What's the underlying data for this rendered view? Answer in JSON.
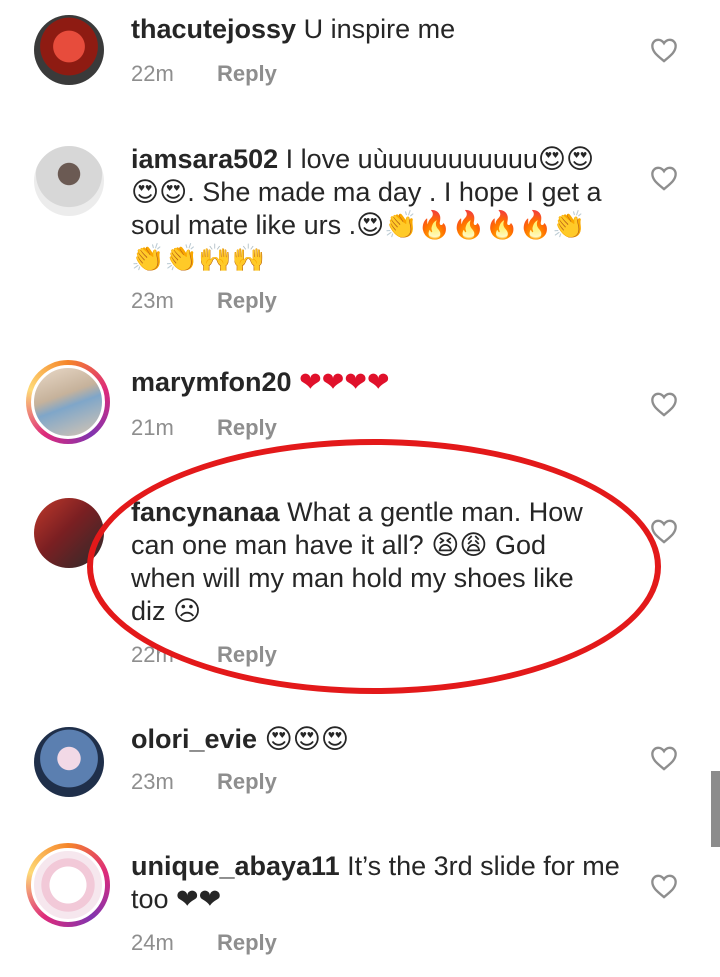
{
  "comments": [
    {
      "username": "thacutejossy",
      "text": " U inspire me",
      "time": "22m",
      "reply": "Reply",
      "ring": false,
      "avatar_color": "#c0392b"
    },
    {
      "username": "iamsara502",
      "text": " I love uùuuuuuuuuuu😍😍 😍😍. She made ma day . I hope I get a soul mate like urs .😍👏🔥🔥🔥🔥👏 👏👏🙌🙌",
      "time": "23m",
      "reply": "Reply",
      "ring": false,
      "avatar_color": "#bdbdbd"
    },
    {
      "username": "marymfon20",
      "text": " ❤❤❤❤",
      "time": "21m",
      "reply": "Reply",
      "ring": true,
      "avatar_color": "#7fa6c9"
    },
    {
      "username": "fancynanaa",
      "text": " What a gentle man. How can one man have it all? 😫😩 God when will my man hold my shoes like diz ☹",
      "time": "22m",
      "reply": "Reply",
      "ring": false,
      "avatar_color": "#7a1f22"
    },
    {
      "username": "olori_evie",
      "text": " 😍😍😍",
      "time": "23m",
      "reply": "Reply",
      "ring": false,
      "avatar_color": "#5b7fb0"
    },
    {
      "username": "unique_abaya11",
      "text": " It’s the 3rd slide for me too ❤❤",
      "time": "24m",
      "reply": "Reply",
      "ring": true,
      "avatar_color": "#f6e7ee"
    }
  ],
  "icons": {
    "like": "heart-outline-icon"
  },
  "colors": {
    "annotation": "#e3191a",
    "meta": "#8e8e8e",
    "text": "#262626"
  }
}
